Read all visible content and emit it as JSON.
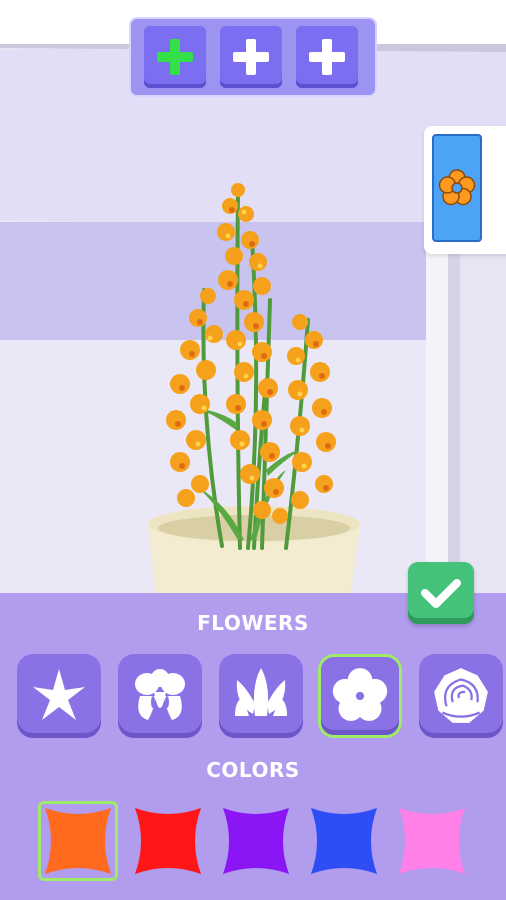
{
  "top_slots": [
    {
      "icon": "plus-icon",
      "color": "#33e04a",
      "active": true
    },
    {
      "icon": "plus-icon",
      "color": "#ffffff",
      "active": false
    },
    {
      "icon": "plus-icon",
      "color": "#ffffff",
      "active": false
    }
  ],
  "side_panel": {
    "icon": "orange-flower-icon",
    "color": "#ff9a1e"
  },
  "confirm": {
    "icon": "checkmark-icon"
  },
  "flowers_title": "FLOWERS",
  "flower_types": [
    {
      "icon": "lily-icon",
      "selected": false
    },
    {
      "icon": "iris-icon",
      "selected": false
    },
    {
      "icon": "tulip-icon",
      "selected": false
    },
    {
      "icon": "five-petal-icon",
      "selected": true
    },
    {
      "icon": "rose-icon",
      "selected": false
    }
  ],
  "colors_title": "COLORS",
  "colors": [
    {
      "name": "orange",
      "hex": "#ff6a1e",
      "selected": true
    },
    {
      "name": "red",
      "hex": "#ff1616",
      "selected": false
    },
    {
      "name": "purple",
      "hex": "#8a16f5",
      "selected": false
    },
    {
      "name": "blue",
      "hex": "#2d4df5",
      "selected": false
    },
    {
      "name": "pink",
      "hex": "#ff80e6",
      "selected": false
    }
  ]
}
